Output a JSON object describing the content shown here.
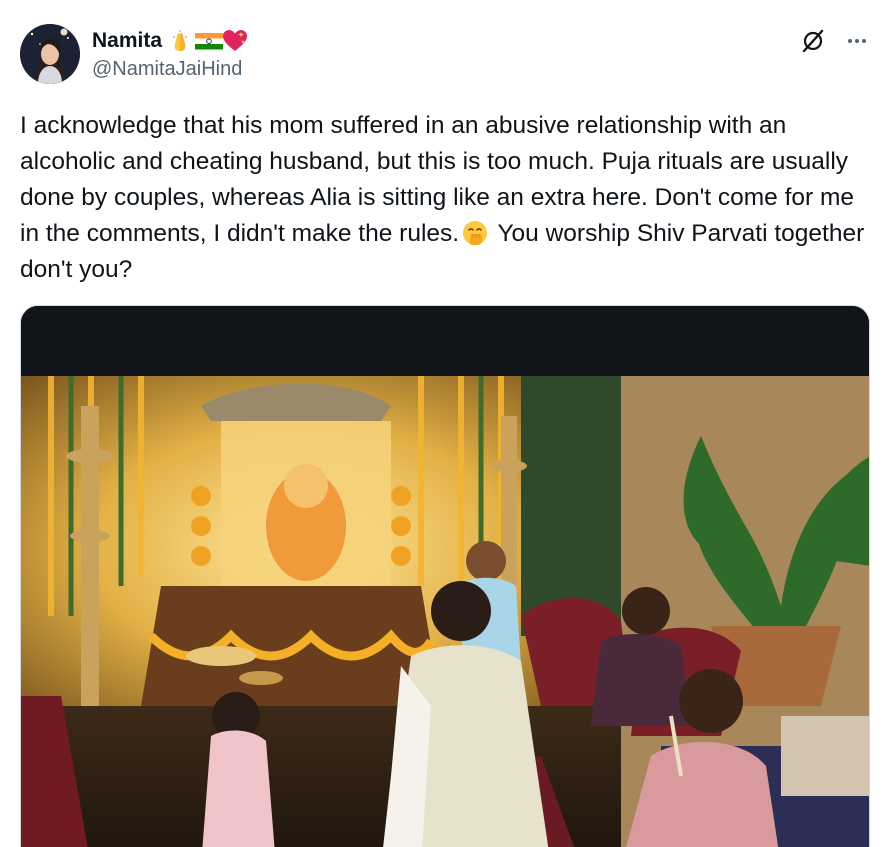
{
  "author": {
    "display_name": "Namita",
    "handle": "@NamitaJaiHind",
    "badges": [
      "folded-hands-emoji",
      "india-flag-emoji",
      "sparkling-heart-emoji"
    ]
  },
  "header_actions": [
    "grok-icon",
    "more-icon"
  ],
  "tweet": {
    "text_part1": "I acknowledge that his mom suffered in an abusive relationship with an alcoholic and cheating husband, but this is too much. Puja rituals are usually done by couples, whereas Alia is sitting like an extra here. Don't come for me in the comments, I didn't make the rules.",
    "emoji": "face-with-hand-over-mouth-emoji",
    "text_part2": " You worship Shiv Parvati together don't you?"
  },
  "media": {
    "kind": "photo"
  }
}
